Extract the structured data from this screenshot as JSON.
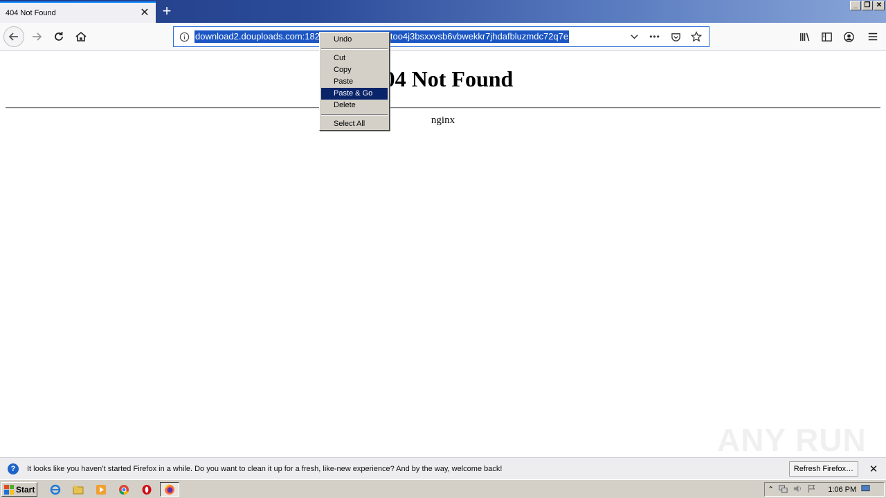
{
  "window": {
    "tab_title": "404 Not Found",
    "tab_close": "✕",
    "new_tab": "+",
    "minimize": "_",
    "restore": "❐",
    "close": "✕"
  },
  "navbar": {
    "url": "download2.douploads.com:182                    kwgije7lzohyjd33too4j3bsxxvsb6vbwekkr7jhdafbluzmdc72q7e",
    "url_visible_start": "download2.douploads.com:182",
    "url_visible_end": "kwgije7lzohyjd33too4j3bsxxvsb6vbwekkr7jhdafbluzmdc72q7e",
    "more": "•••"
  },
  "page": {
    "heading": "404 Not Found",
    "server": "nginx"
  },
  "watermark": "ANY RUN",
  "context_menu": {
    "items": [
      {
        "label": "Undo"
      },
      {
        "label": "Cut"
      },
      {
        "label": "Copy"
      },
      {
        "label": "Paste"
      },
      {
        "label": "Paste & Go"
      },
      {
        "label": "Delete"
      },
      {
        "label": "Select All"
      }
    ],
    "active_color": "#0a246a"
  },
  "notification": {
    "text": "It looks like you haven’t started Firefox in a while. Do you want to clean it up for a fresh, like-new experience? And by the way, welcome back!",
    "button": "Refresh Firefox…",
    "close": "✕"
  },
  "taskbar": {
    "start": "Start",
    "clock": "1:06 PM"
  },
  "colors": {
    "selection": "#1b56c4",
    "tab_accent": "#0a84ff"
  }
}
